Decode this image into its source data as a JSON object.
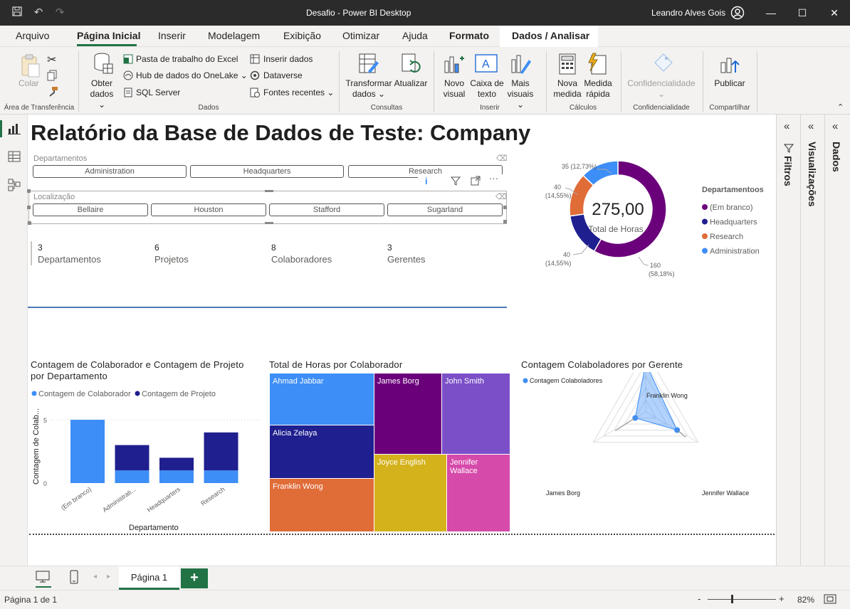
{
  "window": {
    "title": "Desafio - Power BI Desktop",
    "user": "Leandro Alves Gois"
  },
  "menu": [
    "Arquivo",
    "Página Inicial",
    "Inserir",
    "Modelagem",
    "Exibição",
    "Otimizar",
    "Ajuda",
    "Formato",
    "Dados / Analisar"
  ],
  "ribbon": {
    "clipboard": {
      "paste": "Colar",
      "group": "Área de Transferência"
    },
    "data": {
      "get_data_1": "Obter",
      "get_data_2": "dados",
      "excel": "Pasta de trabalho do Excel",
      "onelake": "Hub de dados do OneLake",
      "sql": "SQL Server",
      "enter": "Inserir dados",
      "dataverse": "Dataverse",
      "recent": "Fontes recentes",
      "group": "Dados"
    },
    "queries": {
      "transform_1": "Transformar",
      "transform_2": "dados",
      "refresh": "Atualizar",
      "group": "Consultas"
    },
    "insert": {
      "new_visual_1": "Novo",
      "new_visual_2": "visual",
      "textbox_1": "Caixa de",
      "textbox_2": "texto",
      "more_1": "Mais",
      "more_2": "visuais",
      "group": "Inserir"
    },
    "calc": {
      "measure_1": "Nova",
      "measure_2": "medida",
      "quick_1": "Medida",
      "quick_2": "rápida",
      "group": "Cálculos"
    },
    "sens": {
      "label": "Confidencialidade",
      "group": "Confidencialidade"
    },
    "share": {
      "publish": "Publicar",
      "group": "Compartilhar"
    }
  },
  "panes": {
    "filters": "Filtros",
    "visualizations": "Visualizações",
    "data": "Dados"
  },
  "report": {
    "title": "Relatório da Base de Dados de Teste: Company",
    "slicer_dept": {
      "label": "Departamentos",
      "items": [
        "Administration",
        "Headquarters",
        "Research"
      ]
    },
    "slicer_loc": {
      "label": "Localização",
      "items": [
        "Bellaire",
        "Houston",
        "Stafford",
        "Sugarland"
      ]
    },
    "kpis": [
      {
        "value": "3",
        "label": "Departamentos"
      },
      {
        "value": "6",
        "label": "Projetos"
      },
      {
        "value": "8",
        "label": "Colaboradores"
      },
      {
        "value": "3",
        "label": "Gerentes"
      }
    ]
  },
  "donut": {
    "center_value": "275,00",
    "center_label": "Total de Horas",
    "legend_title": "Departamentoos",
    "labels": {
      "blank": [
        "160",
        "(58,18%)"
      ],
      "hq": [
        "40",
        "(14,55%)"
      ],
      "research": [
        "40",
        "(14,55%)"
      ],
      "admin": "35 (12,73%)"
    }
  },
  "bar_visual": {
    "title": "Contagem de Colaborador e Contagem de Projeto por Departamento",
    "legend": [
      "Contagem de Colaborador",
      "Contagem de Projeto"
    ],
    "ylabel": "Contagem de Colab...",
    "xlabel": "Departamento",
    "categories": [
      "(Em branco)",
      "Administrati...",
      "Headquarters",
      "Research"
    ],
    "yticks": [
      "0",
      "5"
    ]
  },
  "treemap": {
    "title": "Total de Horas por Colaborador",
    "items": [
      "Ahmad Jabbar",
      "James Borg",
      "John Smith",
      "Alicia Zelaya",
      "Joyce English",
      "Jennifer Wallace",
      "Franklin Wong"
    ]
  },
  "radar": {
    "title": "Contagem Colaboladores por Gerente",
    "legend": "Contagem Colaboladores",
    "axes": [
      "Franklin Wong",
      "Jennifer Wallace",
      "James Borg"
    ]
  },
  "chart_data": [
    {
      "type": "pie",
      "title": "",
      "legend_title": "Departamentoos",
      "categories": [
        "(Em branco)",
        "Headquarters",
        "Research",
        "Administration"
      ],
      "values": [
        160,
        40,
        40,
        35
      ],
      "total": 275,
      "colors": [
        "#6b007b",
        "#1f1f8f",
        "#e06c38",
        "#3d8ef7"
      ]
    },
    {
      "type": "bar",
      "title": "Contagem de Colaborador e Contagem de Projeto por Departamento",
      "categories": [
        "(Em branco)",
        "Administrati...",
        "Headquarters",
        "Research"
      ],
      "series": [
        {
          "name": "Contagem de Colaborador",
          "values": [
            5,
            1,
            1,
            1
          ]
        },
        {
          "name": "Contagem de Projeto",
          "values": [
            0,
            2,
            1,
            3
          ]
        }
      ],
      "stacked": true,
      "ylim": [
        0,
        6
      ],
      "xlabel": "Departamento",
      "ylabel": "Contagem de Colab...",
      "colors": [
        "#3d8ef7",
        "#1f1f8f"
      ]
    },
    {
      "type": "table",
      "title": "Total de Horas por Colaborador",
      "categories": [
        "Ahmad Jabbar",
        "Alicia Zelaya",
        "Franklin Wong",
        "James Borg",
        "Joyce English",
        "John Smith",
        "Jennifer Wallace"
      ],
      "colors": [
        "#3d8ef7",
        "#1f1f8f",
        "#e06c38",
        "#6b007b",
        "#d4b21c",
        "#7b4fc8",
        "#d64aaa"
      ]
    },
    {
      "type": "line",
      "title": "Contagem Colaboladores por Gerente",
      "categories": [
        "Franklin Wong",
        "Jennifer Wallace",
        "James Borg"
      ],
      "series": [
        {
          "name": "Contagem Colaboladores",
          "values": [
            4,
            3,
            1
          ]
        }
      ],
      "colors": [
        "#3d8ef7"
      ]
    }
  ],
  "pages": {
    "tab": "Página 1",
    "status": "Página 1 de 1",
    "zoom": "82%"
  },
  "colors": {
    "accent": "#217346",
    "titlebar": "#2b2b2b"
  }
}
